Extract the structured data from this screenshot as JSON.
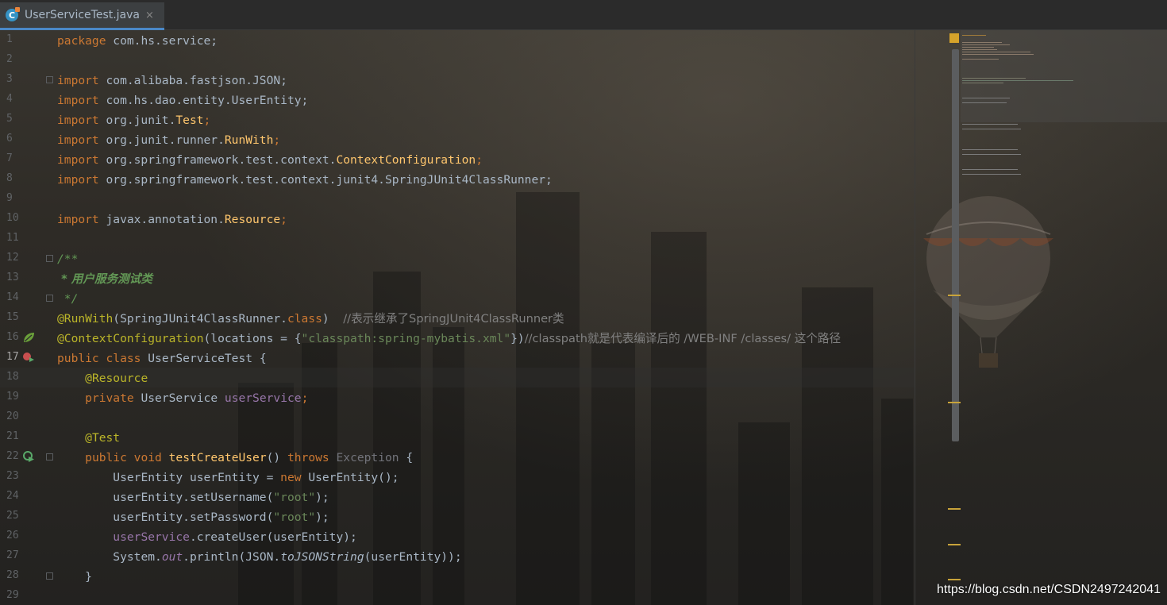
{
  "tab": {
    "title": "UserServiceTest.java",
    "close_glyph": "×",
    "icon": "java-class-icon"
  },
  "editor": {
    "current_line": "17",
    "lines": [
      {
        "num": "1"
      },
      {
        "num": "2"
      },
      {
        "num": "3"
      },
      {
        "num": "4"
      },
      {
        "num": "5"
      },
      {
        "num": "6"
      },
      {
        "num": "7"
      },
      {
        "num": "8"
      },
      {
        "num": "9"
      },
      {
        "num": "10"
      },
      {
        "num": "11"
      },
      {
        "num": "12"
      },
      {
        "num": "13"
      },
      {
        "num": "14"
      },
      {
        "num": "15"
      },
      {
        "num": "16"
      },
      {
        "num": "17"
      },
      {
        "num": "18"
      },
      {
        "num": "19"
      },
      {
        "num": "20"
      },
      {
        "num": "21"
      },
      {
        "num": "22"
      },
      {
        "num": "23"
      },
      {
        "num": "24"
      },
      {
        "num": "25"
      },
      {
        "num": "26"
      },
      {
        "num": "27"
      },
      {
        "num": "28"
      },
      {
        "num": "29"
      }
    ],
    "code": {
      "l1": {
        "kw": "package",
        "rest": " com.hs.service;"
      },
      "l3": {
        "kw": "import",
        "rest": " com.alibaba.fastjson.JSON;"
      },
      "l4": {
        "kw": "import",
        "rest": " com.hs.dao.entity.UserEntity;"
      },
      "l5": {
        "kw": "import",
        "pre": " org.junit.",
        "cls": "Test",
        "post": ";"
      },
      "l6": {
        "kw": "import",
        "pre": " org.junit.runner.",
        "cls": "RunWith",
        "post": ";"
      },
      "l7": {
        "kw": "import",
        "pre": " org.springframework.test.context.",
        "cls": "ContextConfiguration",
        "post": ";"
      },
      "l8": {
        "kw": "import",
        "rest": " org.springframework.test.context.junit4.SpringJUnit4ClassRunner;"
      },
      "l10": {
        "kw": "import",
        "pre": " javax.annotation.",
        "cls": "Resource",
        "post": ";"
      },
      "l12": "/**",
      "l13": " * 用户服务测试类",
      "l14": " */",
      "l15": {
        "ann": "@RunWith",
        "a": "(SpringJUnit4ClassRunner.",
        "kw": "class",
        "b": ")  ",
        "cmt": "//表示继承了SpringJUnit4ClassRunner类"
      },
      "l16": {
        "ann": "@ContextConfiguration",
        "a": "(locations = {",
        "str": "\"classpath:spring-mybatis.xml\"",
        "b": "})",
        "cmt": "//classpath就是代表编译后的 /WEB-INF /classes/ 这个路径"
      },
      "l17": {
        "kw1": "public",
        "kw2": "class",
        "name": "UserServiceTest",
        "rest": " {"
      },
      "l18": {
        "ann": "@Resource"
      },
      "l19": {
        "kw": "private",
        "type": " UserService ",
        "field": "userService",
        "rest": ";"
      },
      "l21": {
        "ann": "@Test"
      },
      "l22": {
        "kw1": "public",
        "kw2": "void",
        "method": "testCreateUser",
        "a": "() ",
        "kw3": "throws",
        "exc": " Exception",
        "rest": " {"
      },
      "l23": {
        "a": "UserEntity userEntity = ",
        "kw": "new",
        "b": " UserEntity();"
      },
      "l24": {
        "a": "userEntity.setUsername(",
        "str": "\"root\"",
        "b": ");"
      },
      "l25": {
        "a": "userEntity.setPassword(",
        "str": "\"root\"",
        "b": ");"
      },
      "l26": {
        "field": "userService",
        "b": ".createUser(userEntity);"
      },
      "l27": {
        "a": "System.",
        "sf": "out",
        "b": ".println(JSON.",
        "im": "toJSONString",
        "c": "(userEntity));"
      },
      "l28": "}"
    }
  },
  "watermark": "https://blog.csdn.net/CSDN2497242041",
  "colors": {
    "keyword": "#cc7832",
    "annotation": "#bbb529",
    "string": "#6a8759",
    "comment": "#808080",
    "doc": "#629755",
    "field": "#9876aa",
    "method": "#ffc66d",
    "text": "#a9b7c6"
  }
}
